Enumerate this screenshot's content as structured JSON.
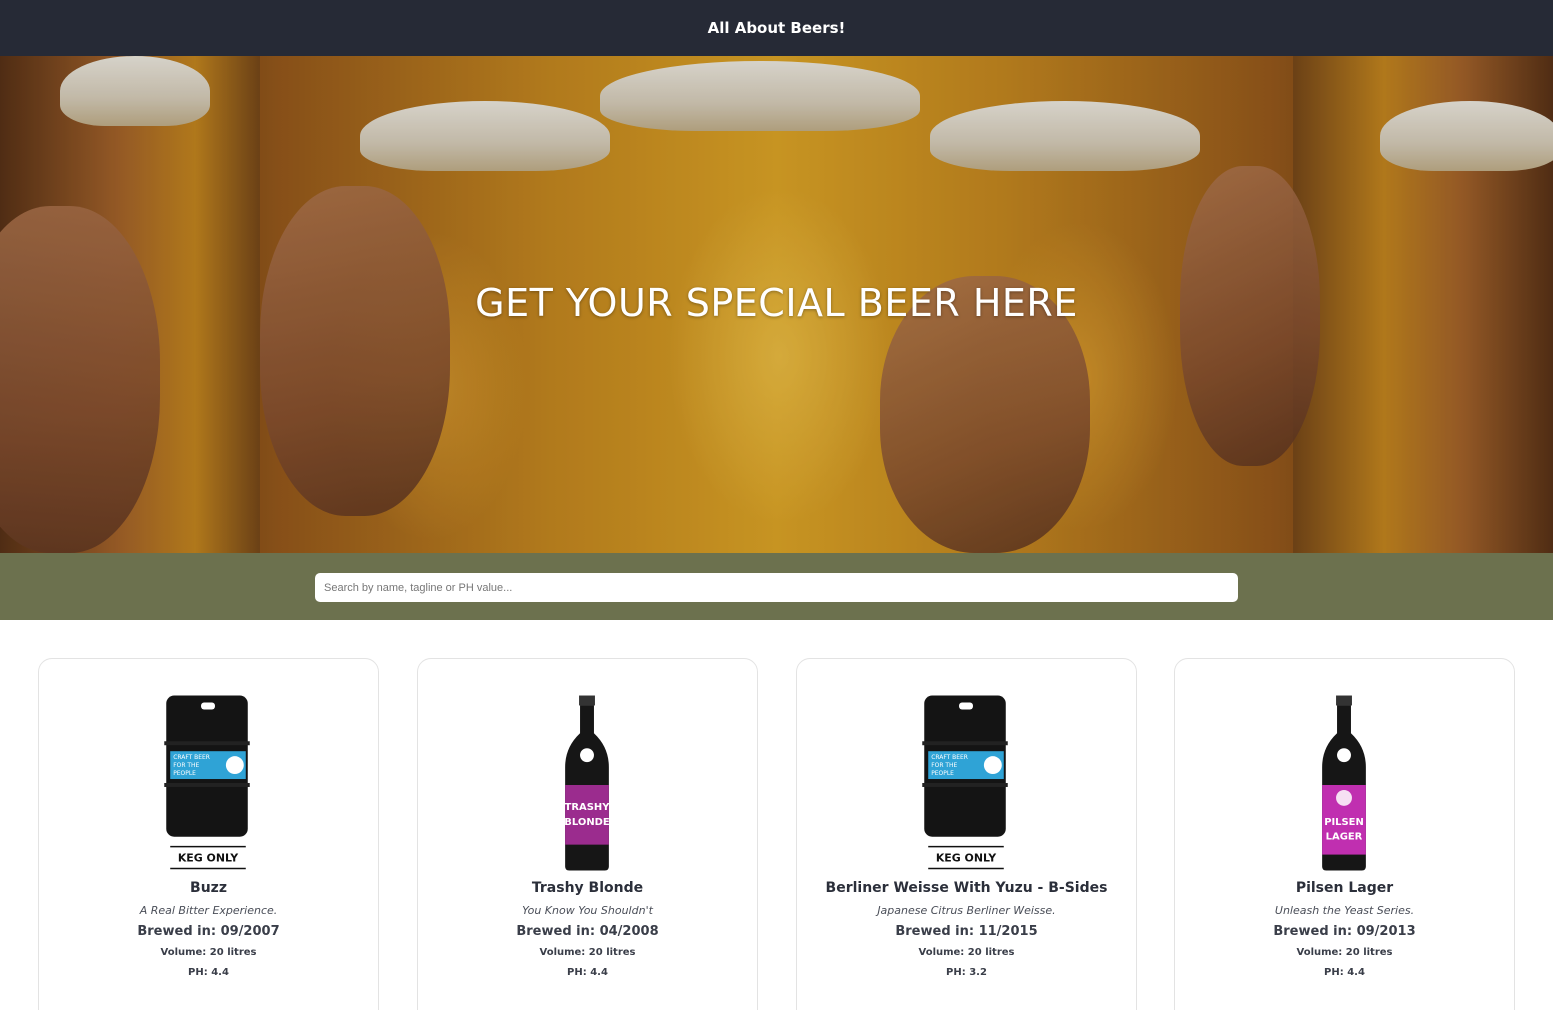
{
  "header": {
    "title": "All About Beers!"
  },
  "hero": {
    "title": "GET YOUR SPECIAL BEER HERE"
  },
  "search": {
    "placeholder": "Search by name, tagline or PH value...",
    "value": ""
  },
  "colors": {
    "topbar": "#262a36",
    "search_band": "#6c714e",
    "label_blue": "#2fa3d6",
    "label_purple": "#9b2c8e"
  },
  "beers": [
    {
      "name": "Buzz",
      "tagline": "A Real Bitter Experience.",
      "brewed": "Brewed in: 09/2007",
      "volume": "Volume: 20 litres",
      "ph": "PH: 4.4",
      "image": "keg-icon",
      "keg_label": "KEG ONLY",
      "keg_text": "CRAFT BEER FOR THE PEOPLE"
    },
    {
      "name": "Trashy Blonde",
      "tagline": "You Know You Shouldn't",
      "brewed": "Brewed in: 04/2008",
      "volume": "Volume: 20 litres",
      "ph": "PH: 4.4",
      "image": "bottle-icon",
      "bottle_label": "TRASHY BLONDE"
    },
    {
      "name": "Berliner Weisse With Yuzu - B-Sides",
      "tagline": "Japanese Citrus Berliner Weisse.",
      "brewed": "Brewed in: 11/2015",
      "volume": "Volume: 20 litres",
      "ph": "PH: 3.2",
      "image": "keg-icon",
      "keg_label": "KEG ONLY",
      "keg_text": "CRAFT BEER FOR THE PEOPLE"
    },
    {
      "name": "Pilsen Lager",
      "tagline": "Unleash the Yeast Series.",
      "brewed": "Brewed in: 09/2013",
      "volume": "Volume: 20 litres",
      "ph": "PH: 4.4",
      "image": "bottle-icon",
      "bottle_label": "PILSEN LAGER"
    }
  ]
}
